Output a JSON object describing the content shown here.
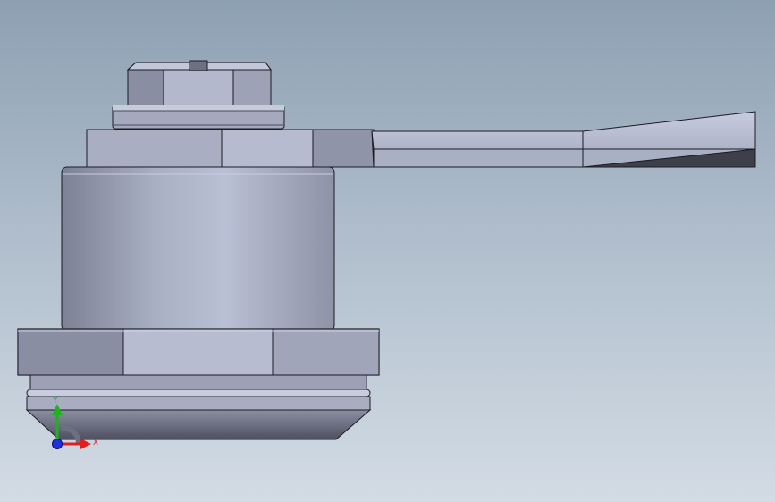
{
  "viewport": {
    "background_top": "#8da0b2",
    "background_bottom": "#d3dce5"
  },
  "model": {
    "part": "latch-assembly",
    "colors": {
      "body_light": "#b8bed3",
      "body_mid": "#9ea4b8",
      "body_dark": "#6c7083",
      "edge": "#1b1b22",
      "shadow": "#3d3f49"
    }
  },
  "triad": {
    "x_label": "X",
    "y_label": "Y",
    "x_color": "#e02020",
    "y_color": "#20b020",
    "z_color": "#2030e0"
  }
}
